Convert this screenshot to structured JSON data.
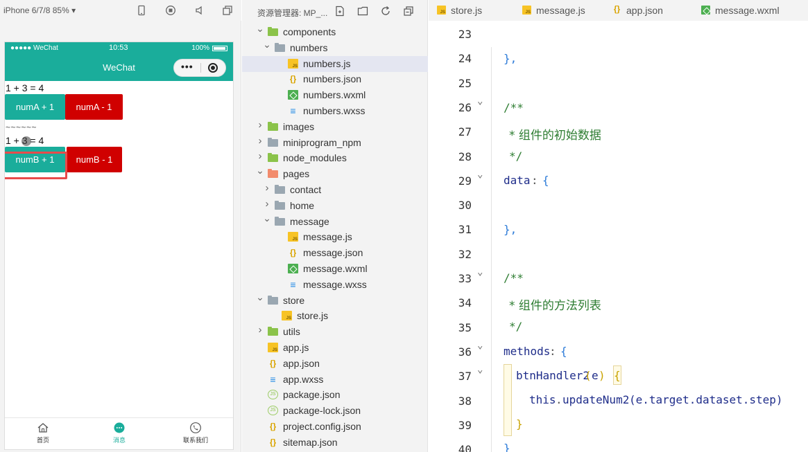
{
  "simulator": {
    "device_label": "iPhone 6/7/8 85% ▾",
    "status": {
      "carrier": "●●●●● WeChat",
      "time": "10:53",
      "battery": "100%"
    },
    "nav_title": "WeChat",
    "lines": {
      "eq1": "1 + 3 = 4",
      "tildes": "~~~~~~",
      "eq2": "1 + 3 = 4"
    },
    "buttons": {
      "numA_plus": "numA + 1",
      "numA_minus": "numA - 1",
      "numB_plus": "numB + 1",
      "numB_minus": "numB - 1"
    },
    "tabbar": [
      {
        "label": "首页"
      },
      {
        "label": "消息"
      },
      {
        "label": "联系我们"
      }
    ],
    "colors": {
      "primary": "#1aad9b",
      "danger": "#d00000",
      "highlight": "#e84b4b"
    }
  },
  "explorer": {
    "title": "资源管理器: MP_...",
    "tree": [
      {
        "label": "components",
        "icon": "folder-green",
        "chevron": "open"
      },
      {
        "label": "numbers",
        "icon": "folder",
        "chevron": "open"
      },
      {
        "label": "numbers.js",
        "icon": "js",
        "selected": true
      },
      {
        "label": "numbers.json",
        "icon": "json"
      },
      {
        "label": "numbers.wxml",
        "icon": "wxml"
      },
      {
        "label": "numbers.wxss",
        "icon": "wxss"
      },
      {
        "label": "images",
        "icon": "folder-green",
        "chevron": "closed"
      },
      {
        "label": "miniprogram_npm",
        "icon": "folder",
        "chevron": "closed"
      },
      {
        "label": "node_modules",
        "icon": "folder-green",
        "chevron": "closed"
      },
      {
        "label": "pages",
        "icon": "folder-red",
        "chevron": "open"
      },
      {
        "label": "contact",
        "icon": "folder",
        "chevron": "closed"
      },
      {
        "label": "home",
        "icon": "folder",
        "chevron": "closed"
      },
      {
        "label": "message",
        "icon": "folder",
        "chevron": "open"
      },
      {
        "label": "message.js",
        "icon": "js"
      },
      {
        "label": "message.json",
        "icon": "json"
      },
      {
        "label": "message.wxml",
        "icon": "wxml"
      },
      {
        "label": "message.wxss",
        "icon": "wxss"
      },
      {
        "label": "store",
        "icon": "folder",
        "chevron": "open"
      },
      {
        "label": "store.js",
        "icon": "js"
      },
      {
        "label": "utils",
        "icon": "folder-green",
        "chevron": "closed"
      },
      {
        "label": "app.js",
        "icon": "js"
      },
      {
        "label": "app.json",
        "icon": "json"
      },
      {
        "label": "app.wxss",
        "icon": "wxss"
      },
      {
        "label": "package.json",
        "icon": "pkg"
      },
      {
        "label": "package-lock.json",
        "icon": "pkg"
      },
      {
        "label": "project.config.json",
        "icon": "json"
      },
      {
        "label": "sitemap.json",
        "icon": "json"
      }
    ]
  },
  "editor": {
    "tabs": [
      {
        "label": "store.js",
        "icon": "js"
      },
      {
        "label": "message.js",
        "icon": "js"
      },
      {
        "label": "app.json",
        "icon": "json"
      },
      {
        "label": "message.wxml",
        "icon": "wxml"
      }
    ],
    "line_numbers": [
      "23",
      "24",
      "25",
      "26",
      "27",
      "28",
      "29",
      "30",
      "31",
      "32",
      "33",
      "34",
      "35",
      "36",
      "37",
      "38",
      "39",
      "40"
    ],
    "code": {
      "l24": "},",
      "l26": "/**",
      "l27": "* 组件的初始数据",
      "l28": "*/",
      "l29_key": "data",
      "l29_punc": ":",
      "l29_brace": "{",
      "l31": "},",
      "l33": "/**",
      "l34": "* 组件的方法列表",
      "l35": "*/",
      "l36_key": "methods",
      "l36_punc": ":",
      "l36_brace": "{",
      "l37_fn": "btnHandler2",
      "l37_paren_open": "(",
      "l37_arg": "e",
      "l37_paren_close": ")",
      "l37_brace": "{",
      "l38_this": "this",
      "l38_dot": ".",
      "l38_fn": "updateNum2",
      "l38_args": "(e.target.dataset.step)",
      "l39": "}",
      "l40": "}"
    }
  }
}
